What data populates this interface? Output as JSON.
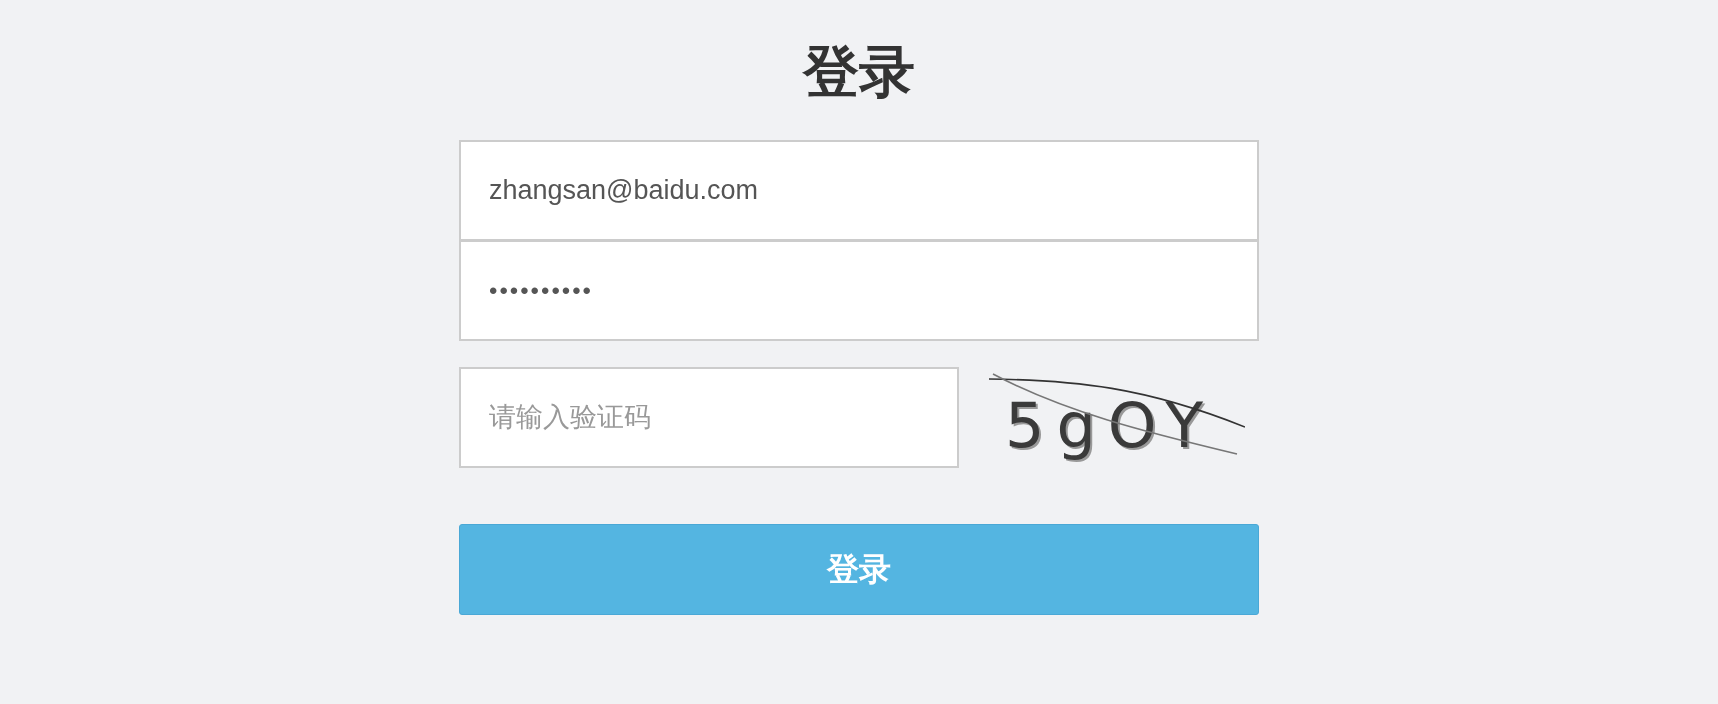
{
  "title": "登录",
  "fields": [
    {
      "kind": "text",
      "value": "zhangsan@baidu.com"
    },
    {
      "kind": "password",
      "value": "••••••••••"
    }
  ],
  "captcha": {
    "placeholder": "请输入验证码",
    "code": "5gOY"
  },
  "submit_button": "登录"
}
